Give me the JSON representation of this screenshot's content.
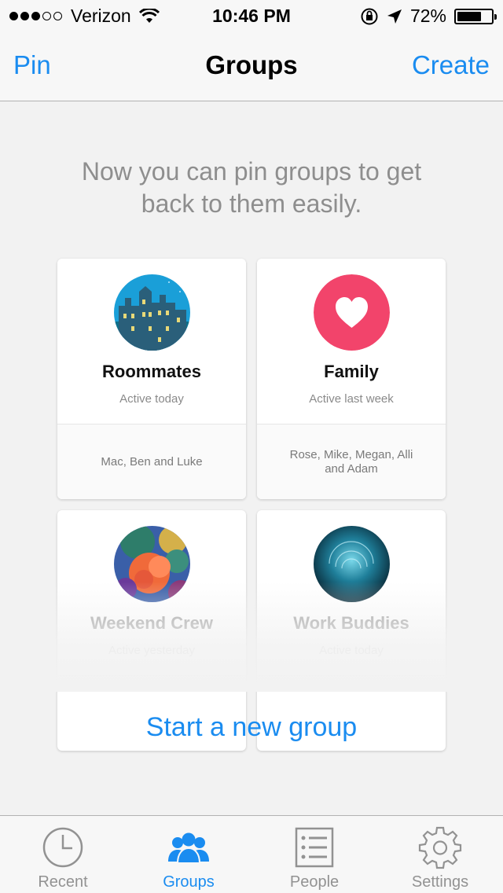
{
  "status_bar": {
    "carrier": "Verizon",
    "signal_bars_filled": 3,
    "signal_bars_total": 5,
    "time": "10:46 PM",
    "battery": "72%",
    "battery_level": 0.72
  },
  "nav": {
    "left_button": "Pin",
    "title": "Groups",
    "right_button": "Create"
  },
  "intro_text": "Now you can pin groups to get back to them easily.",
  "groups": [
    {
      "name": "Roommates",
      "status": "Active today",
      "members": "Mac, Ben and Luke",
      "avatar": "building-photo"
    },
    {
      "name": "Family",
      "status": "Active last week",
      "members": "Rose, Mike, Megan, Alli and Adam",
      "avatar": "heart-icon"
    },
    {
      "name": "Weekend Crew",
      "status": "Active yesterday",
      "avatar": "flower-painting"
    },
    {
      "name": "Work Buddies",
      "status": "Active today",
      "avatar": "fish-school-photo"
    }
  ],
  "start_new_group": "Start a new group",
  "tabs": [
    {
      "label": "Recent",
      "icon": "clock-icon",
      "active": false
    },
    {
      "label": "Groups",
      "icon": "groups-icon",
      "active": true
    },
    {
      "label": "People",
      "icon": "list-icon",
      "active": false
    },
    {
      "label": "Settings",
      "icon": "gear-icon",
      "active": false
    }
  ],
  "colors": {
    "accent": "#1a8cf0",
    "heart_bg": "#f2446b",
    "background": "#f2f2f2"
  }
}
